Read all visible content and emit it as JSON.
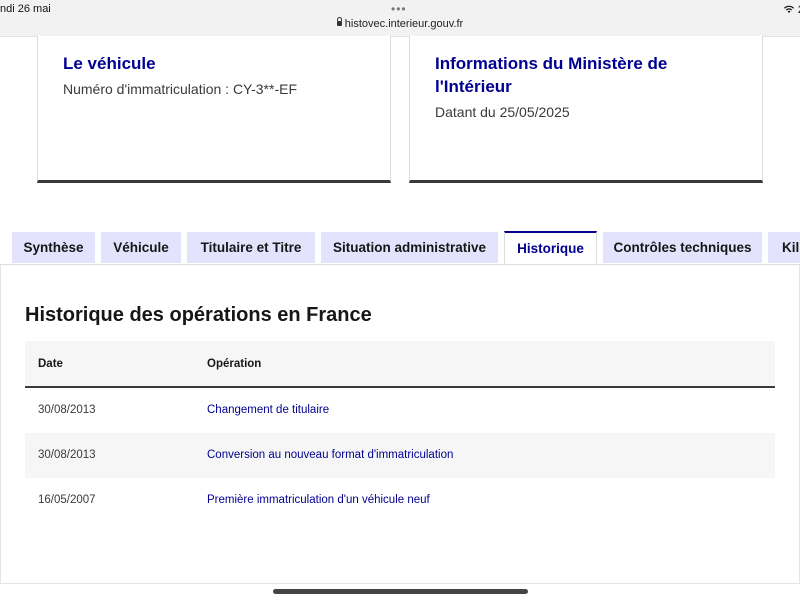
{
  "status_bar": {
    "date": "ndi 26 mai",
    "dots": "•••",
    "url": "histovec.interieur.gouv.fr",
    "right": "2"
  },
  "cards": {
    "vehicle": {
      "title": "Le véhicule",
      "plate_text": "Numéro d'immatriculation : CY-3**-EF"
    },
    "ministry": {
      "title_line1": "Informations du Ministère de",
      "title_line2": "l'Intérieur",
      "date_text": "Datant du 25/05/2025"
    }
  },
  "tabs": [
    {
      "label": "Synthèse",
      "active": false
    },
    {
      "label": "Véhicule",
      "active": false
    },
    {
      "label": "Titulaire et Titre",
      "active": false
    },
    {
      "label": "Situation administrative",
      "active": false
    },
    {
      "label": "Historique",
      "active": true
    },
    {
      "label": "Contrôles techniques",
      "active": false
    },
    {
      "label": "Kil",
      "active": false
    }
  ],
  "history": {
    "title": "Historique des opérations en France",
    "headers": {
      "date": "Date",
      "operation": "Opération"
    },
    "rows": [
      {
        "date": "30/08/2013",
        "operation": "Changement de titulaire"
      },
      {
        "date": "30/08/2013",
        "operation": "Conversion au nouveau format d'immatriculation"
      },
      {
        "date": "16/05/2007",
        "operation": "Première immatriculation d'un véhicule neuf"
      }
    ]
  },
  "colors": {
    "accent": "#000091",
    "tab_bg": "#e3e3fd",
    "row_alt": "#f6f6f6"
  }
}
